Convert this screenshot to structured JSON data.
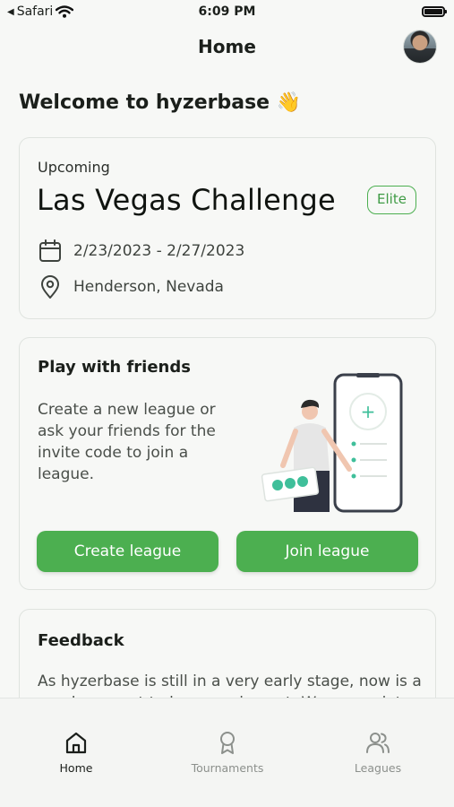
{
  "status_bar": {
    "carrier": "Safari",
    "time": "6:09 PM"
  },
  "header": {
    "title": "Home"
  },
  "welcome": {
    "text": "Welcome to hyzerbase 👋"
  },
  "event": {
    "label": "Upcoming",
    "name": "Las Vegas Challenge",
    "badge": "Elite",
    "dates": "2/23/2023 - 2/27/2023",
    "location": "Henderson, Nevada",
    "accent_color": "#4caf50"
  },
  "friends": {
    "title": "Play with friends",
    "description": "Create a new league or ask your friends for the invite code to join a league.",
    "create_label": "Create league",
    "join_label": "Join league"
  },
  "feedback": {
    "title": "Feedback",
    "text": "As hyzerbase is still in a very early stage, now is a good moment to leave an impact. We appreciate"
  },
  "tabs": [
    {
      "label": "Home",
      "icon": "home-icon",
      "active": true
    },
    {
      "label": "Tournaments",
      "icon": "award-icon",
      "active": false
    },
    {
      "label": "Leagues",
      "icon": "users-icon",
      "active": false
    }
  ]
}
